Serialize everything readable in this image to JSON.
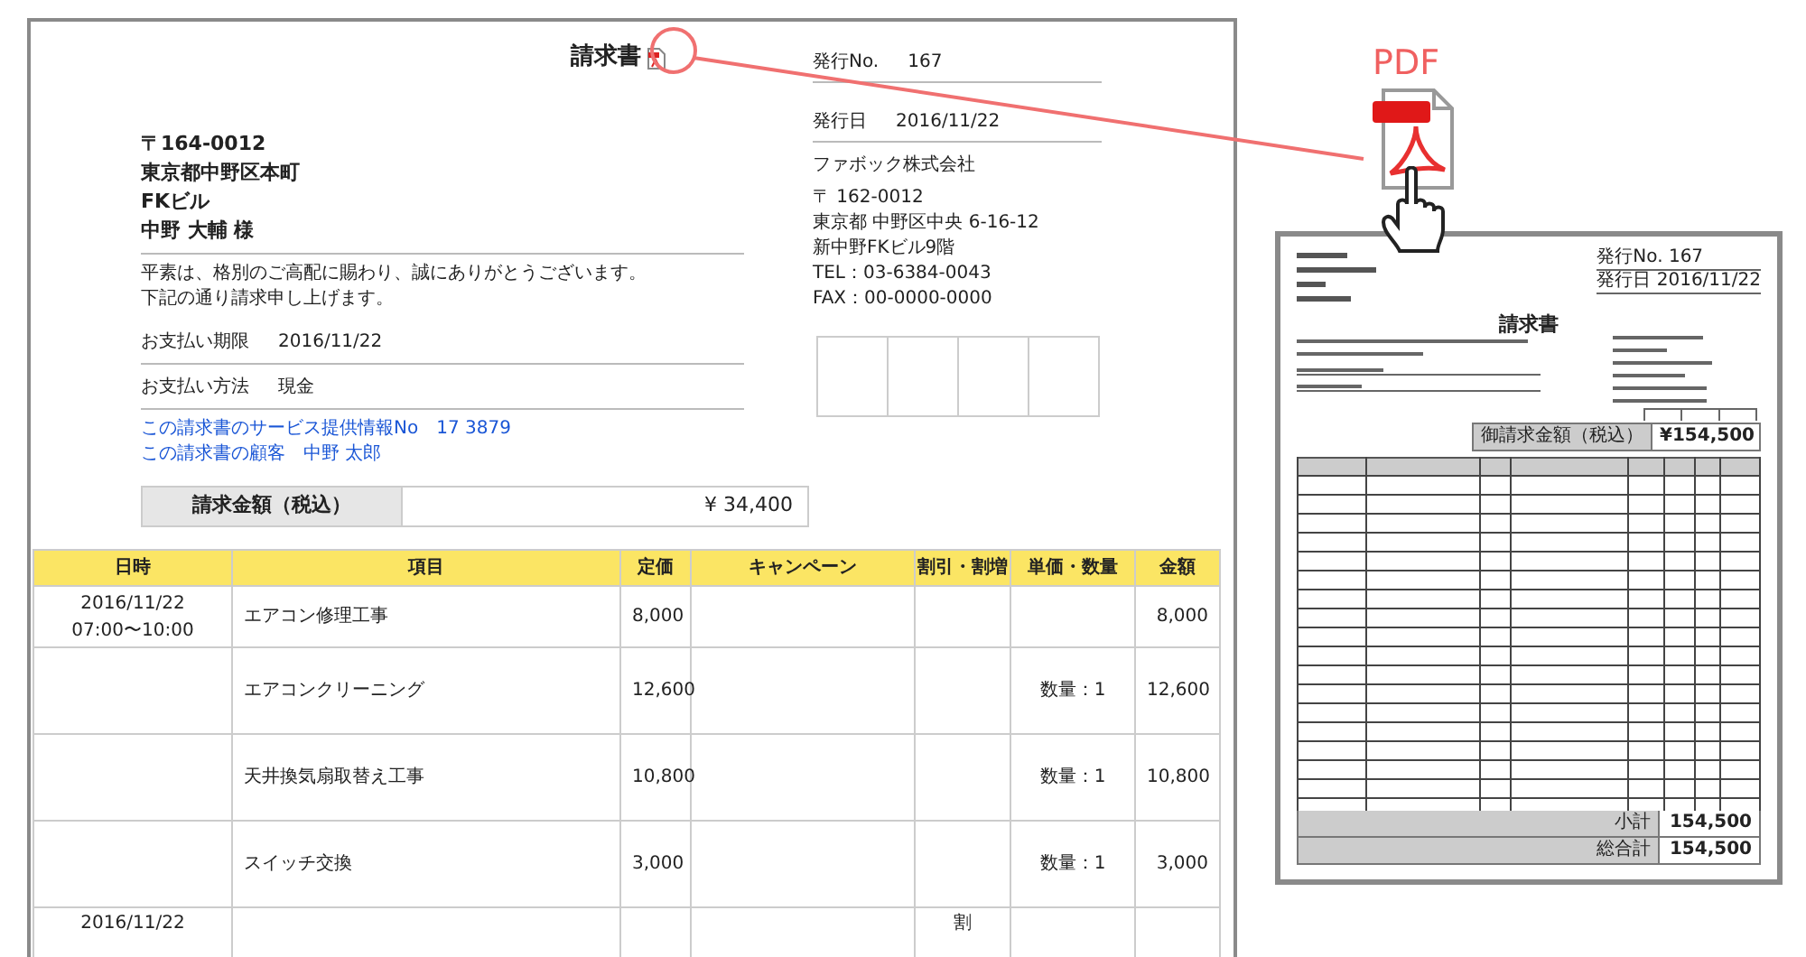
{
  "invoice": {
    "title": "請求書",
    "issue_info": [
      {
        "label": "発行No.",
        "value": "167"
      },
      {
        "label": "発行日",
        "value": "2016/11/22"
      }
    ],
    "recipient": {
      "postal": "〒164-0012",
      "address_lines": [
        "東京都中野区本町",
        "FKビル"
      ],
      "name": "中野 大輔 様"
    },
    "greeting": [
      "平素は、格別のご高配に賜わり、誠にありがとうございます。",
      "下記の通り請求申し上げます。"
    ],
    "payment_fields": [
      {
        "label": "お支払い期限",
        "value": "2016/11/22"
      },
      {
        "label": "お支払い方法",
        "value": "現金"
      }
    ],
    "links": [
      "この請求書のサービス提供情報No　17 3879",
      "この請求書の顧客　中野 太郎"
    ],
    "issuer": {
      "company": "ファボック株式会社",
      "lines": [
        "〒 162-0012",
        "東京都 中野区中央 6-16-12",
        "新中野FKビル9階",
        "TEL：03-6384-0043",
        "FAX：00-0000-0000"
      ]
    },
    "total": {
      "label": "請求金額（税込）",
      "value": "¥ 34,400"
    },
    "table": {
      "columns": [
        "日時",
        "項目",
        "定価",
        "キャンペーン",
        "割引・割増",
        "単価・数量",
        "金額"
      ],
      "rows": [
        {
          "cells": [
            [
              "2016/11/22",
              "07:00〜10:00"
            ],
            "エアコン修理工事",
            "8,000",
            "",
            "",
            "",
            "8,000"
          ]
        },
        {
          "cells": [
            "",
            "エアコンクリーニング",
            "12,600",
            "",
            "",
            "数量：1",
            "12,600"
          ]
        },
        {
          "cells": [
            "",
            "天井換気扇取替え工事",
            "10,800",
            "",
            "",
            "数量：1",
            "10,800"
          ]
        },
        {
          "cells": [
            "",
            "スイッチ交換",
            "3,000",
            "",
            "",
            "数量：1",
            "3,000"
          ]
        },
        {
          "cells": [
            "2016/11/22",
            "",
            "",
            "",
            "割",
            "",
            ""
          ]
        }
      ]
    }
  },
  "pdf_callout": {
    "label": "PDF"
  },
  "preview": {
    "issue_no": "発行No. 167",
    "issue_date": "発行日 2016/11/22",
    "title": "請求書",
    "total_label": "御請求金額（税込）",
    "total": "¥154,500",
    "subtotal_label": "小計",
    "subtotal": "154,500",
    "grand_total_label": "総合計",
    "grand_total": "154,500"
  }
}
